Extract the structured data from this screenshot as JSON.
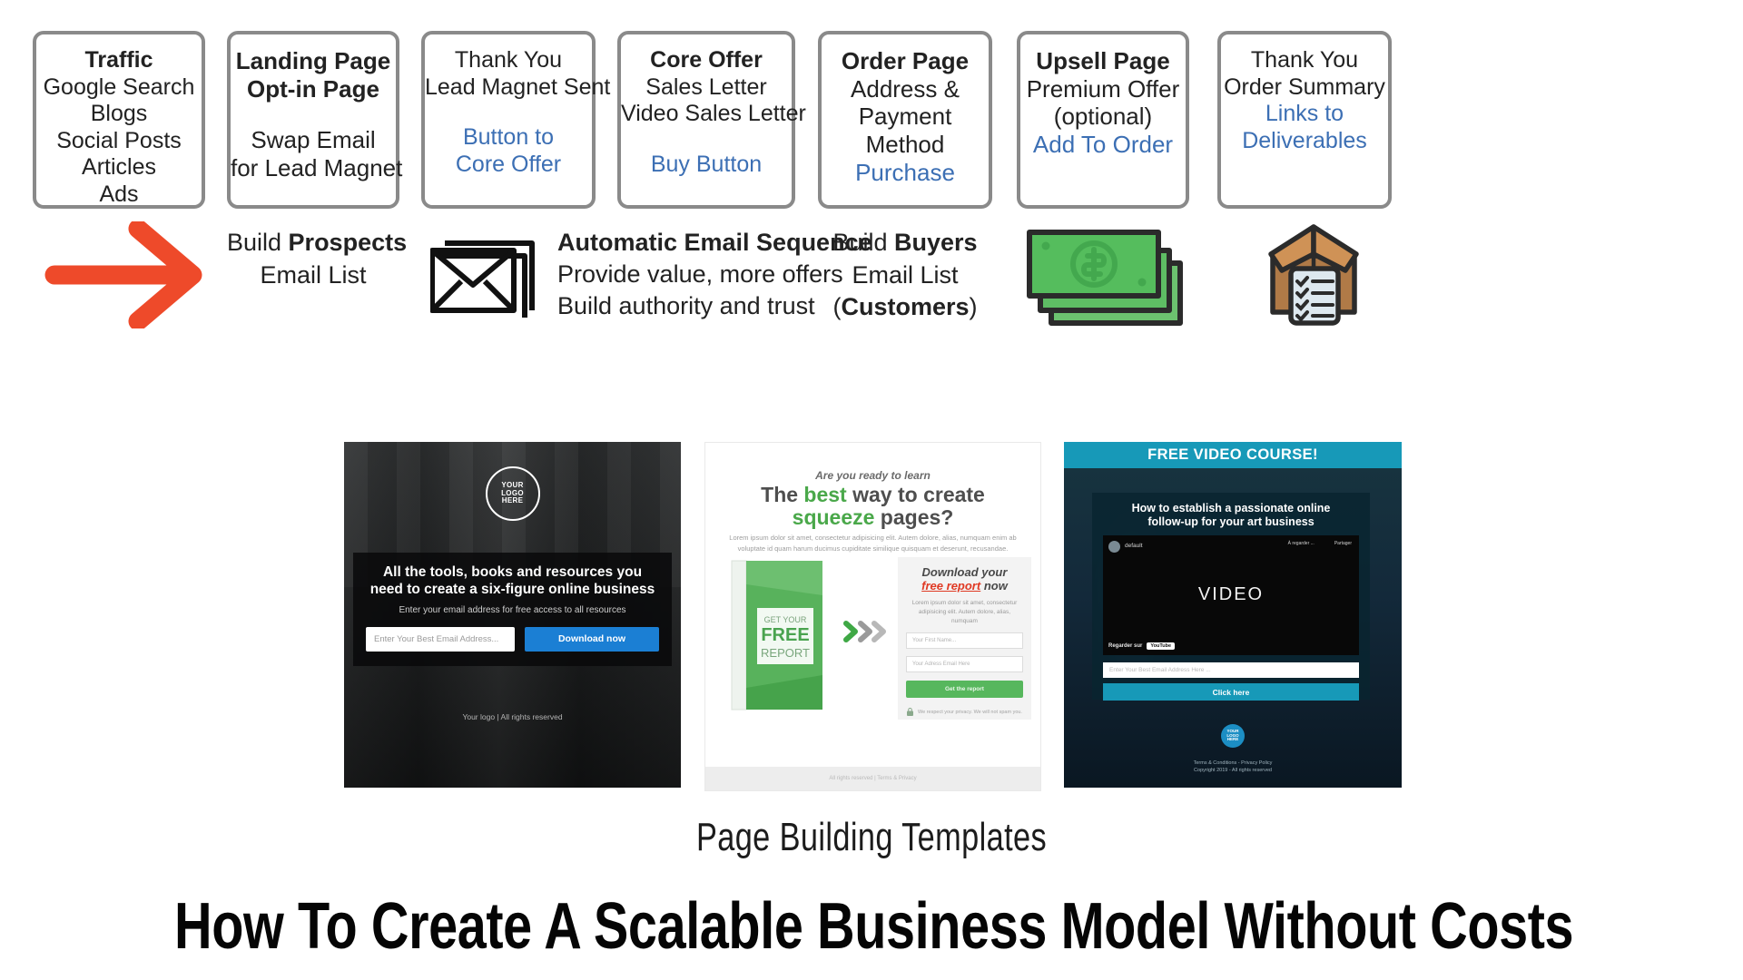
{
  "funnel": {
    "boxes": [
      {
        "name": "traffic",
        "lines": [
          {
            "text": "Traffic",
            "style": "bold"
          },
          {
            "text": "Google Search",
            "style": "normal"
          },
          {
            "text": "Blogs",
            "style": "normal"
          },
          {
            "text": "Social Posts",
            "style": "normal"
          },
          {
            "text": "Articles",
            "style": "normal"
          },
          {
            "text": "Ads",
            "style": "normal"
          }
        ]
      },
      {
        "name": "landing-page",
        "lines": [
          {
            "text": "Landing Page",
            "style": "bold"
          },
          {
            "text": "Opt-in Page",
            "style": "bold"
          },
          {
            "text": "",
            "style": "gap"
          },
          {
            "text": "Swap Email",
            "style": "normal"
          },
          {
            "text": "for Lead Magnet",
            "style": "normal"
          }
        ]
      },
      {
        "name": "thank-you-lead-magnet",
        "lines": [
          {
            "text": "Thank You",
            "style": "normal"
          },
          {
            "text": "Lead Magnet Sent",
            "style": "normal"
          },
          {
            "text": "",
            "style": "gap"
          },
          {
            "text": "Button to",
            "style": "link"
          },
          {
            "text": "Core Offer",
            "style": "link"
          }
        ]
      },
      {
        "name": "core-offer",
        "lines": [
          {
            "text": "Core Offer",
            "style": "bold"
          },
          {
            "text": "Sales Letter",
            "style": "normal"
          },
          {
            "text": "Video Sales Letter",
            "style": "normal"
          },
          {
            "text": "",
            "style": "gap"
          },
          {
            "text": "Buy Button",
            "style": "link"
          }
        ]
      },
      {
        "name": "order-page",
        "lines": [
          {
            "text": "Order Page",
            "style": "bold"
          },
          {
            "text": "Address &",
            "style": "normal"
          },
          {
            "text": "Payment",
            "style": "normal"
          },
          {
            "text": "Method",
            "style": "normal"
          },
          {
            "text": "Purchase",
            "style": "link"
          }
        ]
      },
      {
        "name": "upsell-page",
        "lines": [
          {
            "text": "Upsell Page",
            "style": "bold"
          },
          {
            "text": "Premium Offer",
            "style": "normal"
          },
          {
            "text": "(optional)",
            "style": "normal"
          },
          {
            "text": "Add To Order",
            "style": "link"
          }
        ]
      },
      {
        "name": "thank-you-order-summary",
        "lines": [
          {
            "text": "Thank You",
            "style": "normal"
          },
          {
            "text": "Order Summary",
            "style": "normal"
          },
          {
            "text": "Links to",
            "style": "link"
          },
          {
            "text": "Deliverables",
            "style": "link"
          }
        ]
      }
    ]
  },
  "middle": {
    "arrow_color": "#ee4a2a",
    "prospects": {
      "line1_plain": "Build ",
      "line1_bold": "Prospects",
      "line2": "Email List"
    },
    "email": {
      "heading": "Automatic Email Sequence",
      "line2": "Provide value, more offers",
      "line3": "Build authority and trust"
    },
    "buyers": {
      "line1_plain": "Build ",
      "line1_bold": "Buyers",
      "line2": "Email List",
      "line3_open": "(",
      "line3_bold": "Customers",
      "line3_close": ")"
    }
  },
  "thumbnails": {
    "optin": {
      "logo_l1": "YOUR",
      "logo_l2": "LOGO",
      "logo_l3": "HERE",
      "headline_l1": "All the tools, books and resources you",
      "headline_l2": "need to create a six-figure online business",
      "sub": "Enter your email address for free access to all resources",
      "input_placeholder": "Enter Your Best Email Address...",
      "button": "Download now",
      "footer": "Your logo | All rights reserved"
    },
    "squeeze": {
      "kicker": "Are you ready to learn",
      "h_a": "The ",
      "h_b": "best",
      "h_c": " way to create",
      "h_d": "squeeze",
      "h_e": " pages?",
      "para": "Lorem ipsum dolor sit amet, consectetur adipisicing elit. Autem dolore, alias, numquam enim ab voluptate id quam harum ducimus cupiditate similique quisquam et deserunt, recusandae.",
      "book_l1": "GET YOUR",
      "book_l2": "FREE",
      "book_l3": "REPORT",
      "offer_a": "Download your",
      "offer_b": "free report",
      "offer_c": " now",
      "offer_para": "Lorem ipsum dolor sit amet, consectetur adipisicing elit. Autem dolore, alias, numquam",
      "field1": "Your First Name...",
      "field2": "Your Adress Email Here",
      "cta": "Get the report",
      "privacy": "We respect your privacy. We will not spam you.",
      "footer": "All rights reserved | Terms & Privacy"
    },
    "video": {
      "bar": "FREE VIDEO COURSE!",
      "h_l1": "How to establish a passionate online",
      "h_l2": "follow-up for your art business",
      "channel": "default",
      "meta1": "À regarder ...",
      "meta2": "Partager",
      "word": "VIDEO",
      "watch": "Regarder sur",
      "watch_brand": "YouTube",
      "input_placeholder": "Enter Your Best Email Address Here ...",
      "cta": "Click here",
      "logo_l1": "YOUR",
      "logo_l2": "LOGO",
      "logo_l3": "HERE",
      "foot_l1": "Terms & Conditions - Privacy Policy",
      "foot_l2": "Copyright 2019 - All rights reserved"
    }
  },
  "captions": {
    "templates": "Page Building Templates",
    "headline": "How To Create A Scalable Business Model Without Costs"
  }
}
